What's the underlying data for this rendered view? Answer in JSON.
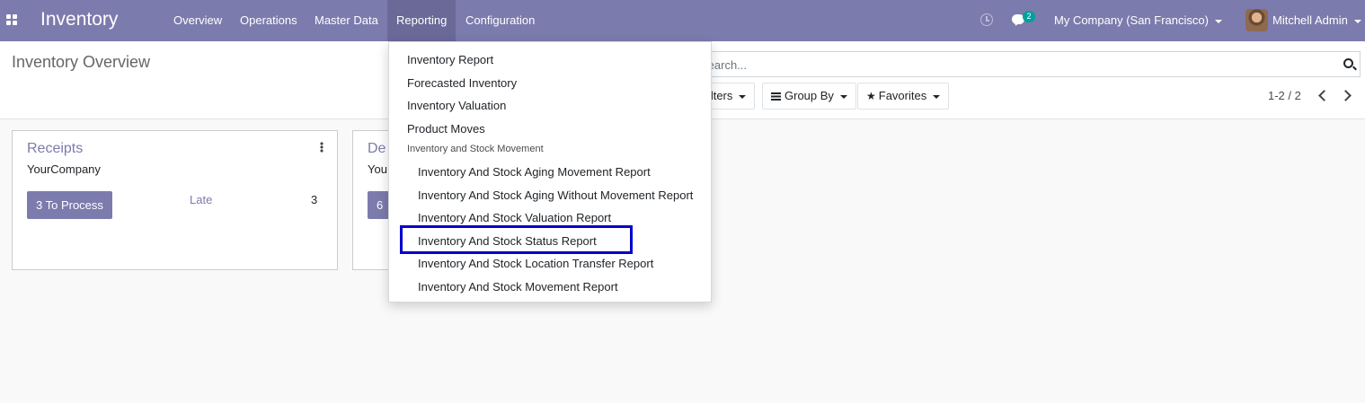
{
  "navbar": {
    "app_title": "Inventory",
    "menu": [
      "Overview",
      "Operations",
      "Master Data",
      "Reporting",
      "Configuration"
    ],
    "active_menu": "Reporting",
    "chat_count": "2",
    "company": "My Company (San Francisco)",
    "user": "Mitchell Admin",
    "icons": [
      "apps-icon",
      "clock-icon",
      "chat-icon",
      "avatar"
    ]
  },
  "control_panel": {
    "title": "Inventory Overview",
    "search_placeholder": "Search...",
    "filters_label": "Filters",
    "groupby_label": "Group By",
    "favorites_label": "Favorites",
    "pager": "1-2 / 2"
  },
  "cards": [
    {
      "title": "Receipts",
      "company": "YourCompany",
      "process_label": "3 To Process",
      "late_label": "Late",
      "late_count": "3"
    },
    {
      "title": "De",
      "company": "You",
      "process_label": "6"
    }
  ],
  "reporting_dropdown": {
    "items": [
      "Inventory Report",
      "Forecasted Inventory",
      "Inventory Valuation",
      "Product Moves"
    ],
    "section_header": "Inventory and Stock Movement",
    "sub_items": [
      "Inventory And Stock Aging Movement Report",
      "Inventory And Stock Aging Without Movement Report",
      "Inventory And Stock Valuation Report",
      "Inventory And Stock Status Report",
      "Inventory And Stock Location Transfer Report",
      "Inventory And Stock Movement Report"
    ],
    "highlighted_item": "Inventory And Stock Status Report",
    "highlight_color": "#0000cc"
  },
  "colors": {
    "navbar": "#7c7bad",
    "accent": "#7c7bad",
    "badge": "#00a09d"
  }
}
